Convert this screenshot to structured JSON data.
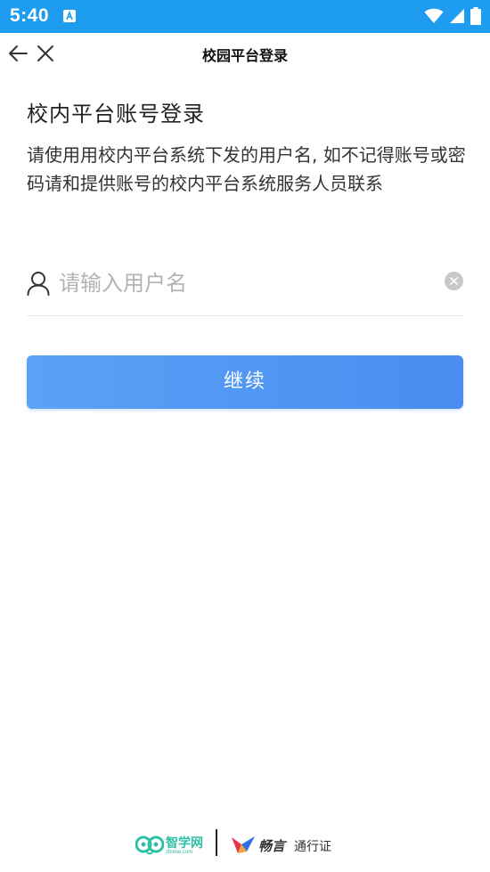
{
  "status_bar": {
    "time": "5:40",
    "background_color": "#1e9cf0",
    "icons": [
      "app-notification-icon",
      "wifi-icon",
      "cellular-signal-icon",
      "battery-icon"
    ]
  },
  "nav": {
    "title": "校园平台登录",
    "back_icon": "arrow-left-icon",
    "close_icon": "close-icon"
  },
  "login": {
    "heading": "校内平台账号登录",
    "description": "请使用用校内平台系统下发的用户名, 如不记得账号或密码请和提供账号的校内平台系统服务人员联系",
    "username": {
      "value": "",
      "placeholder": "请输入用户名",
      "icon": "user-icon",
      "clear_icon": "clear-icon"
    },
    "continue_label": "继续",
    "accent_color": "#4a8cf0"
  },
  "footer": {
    "zhixue_name": "智学网",
    "zhixue_domain": "zhixue.com",
    "changyan_name": "畅言",
    "passport": "通行证"
  }
}
